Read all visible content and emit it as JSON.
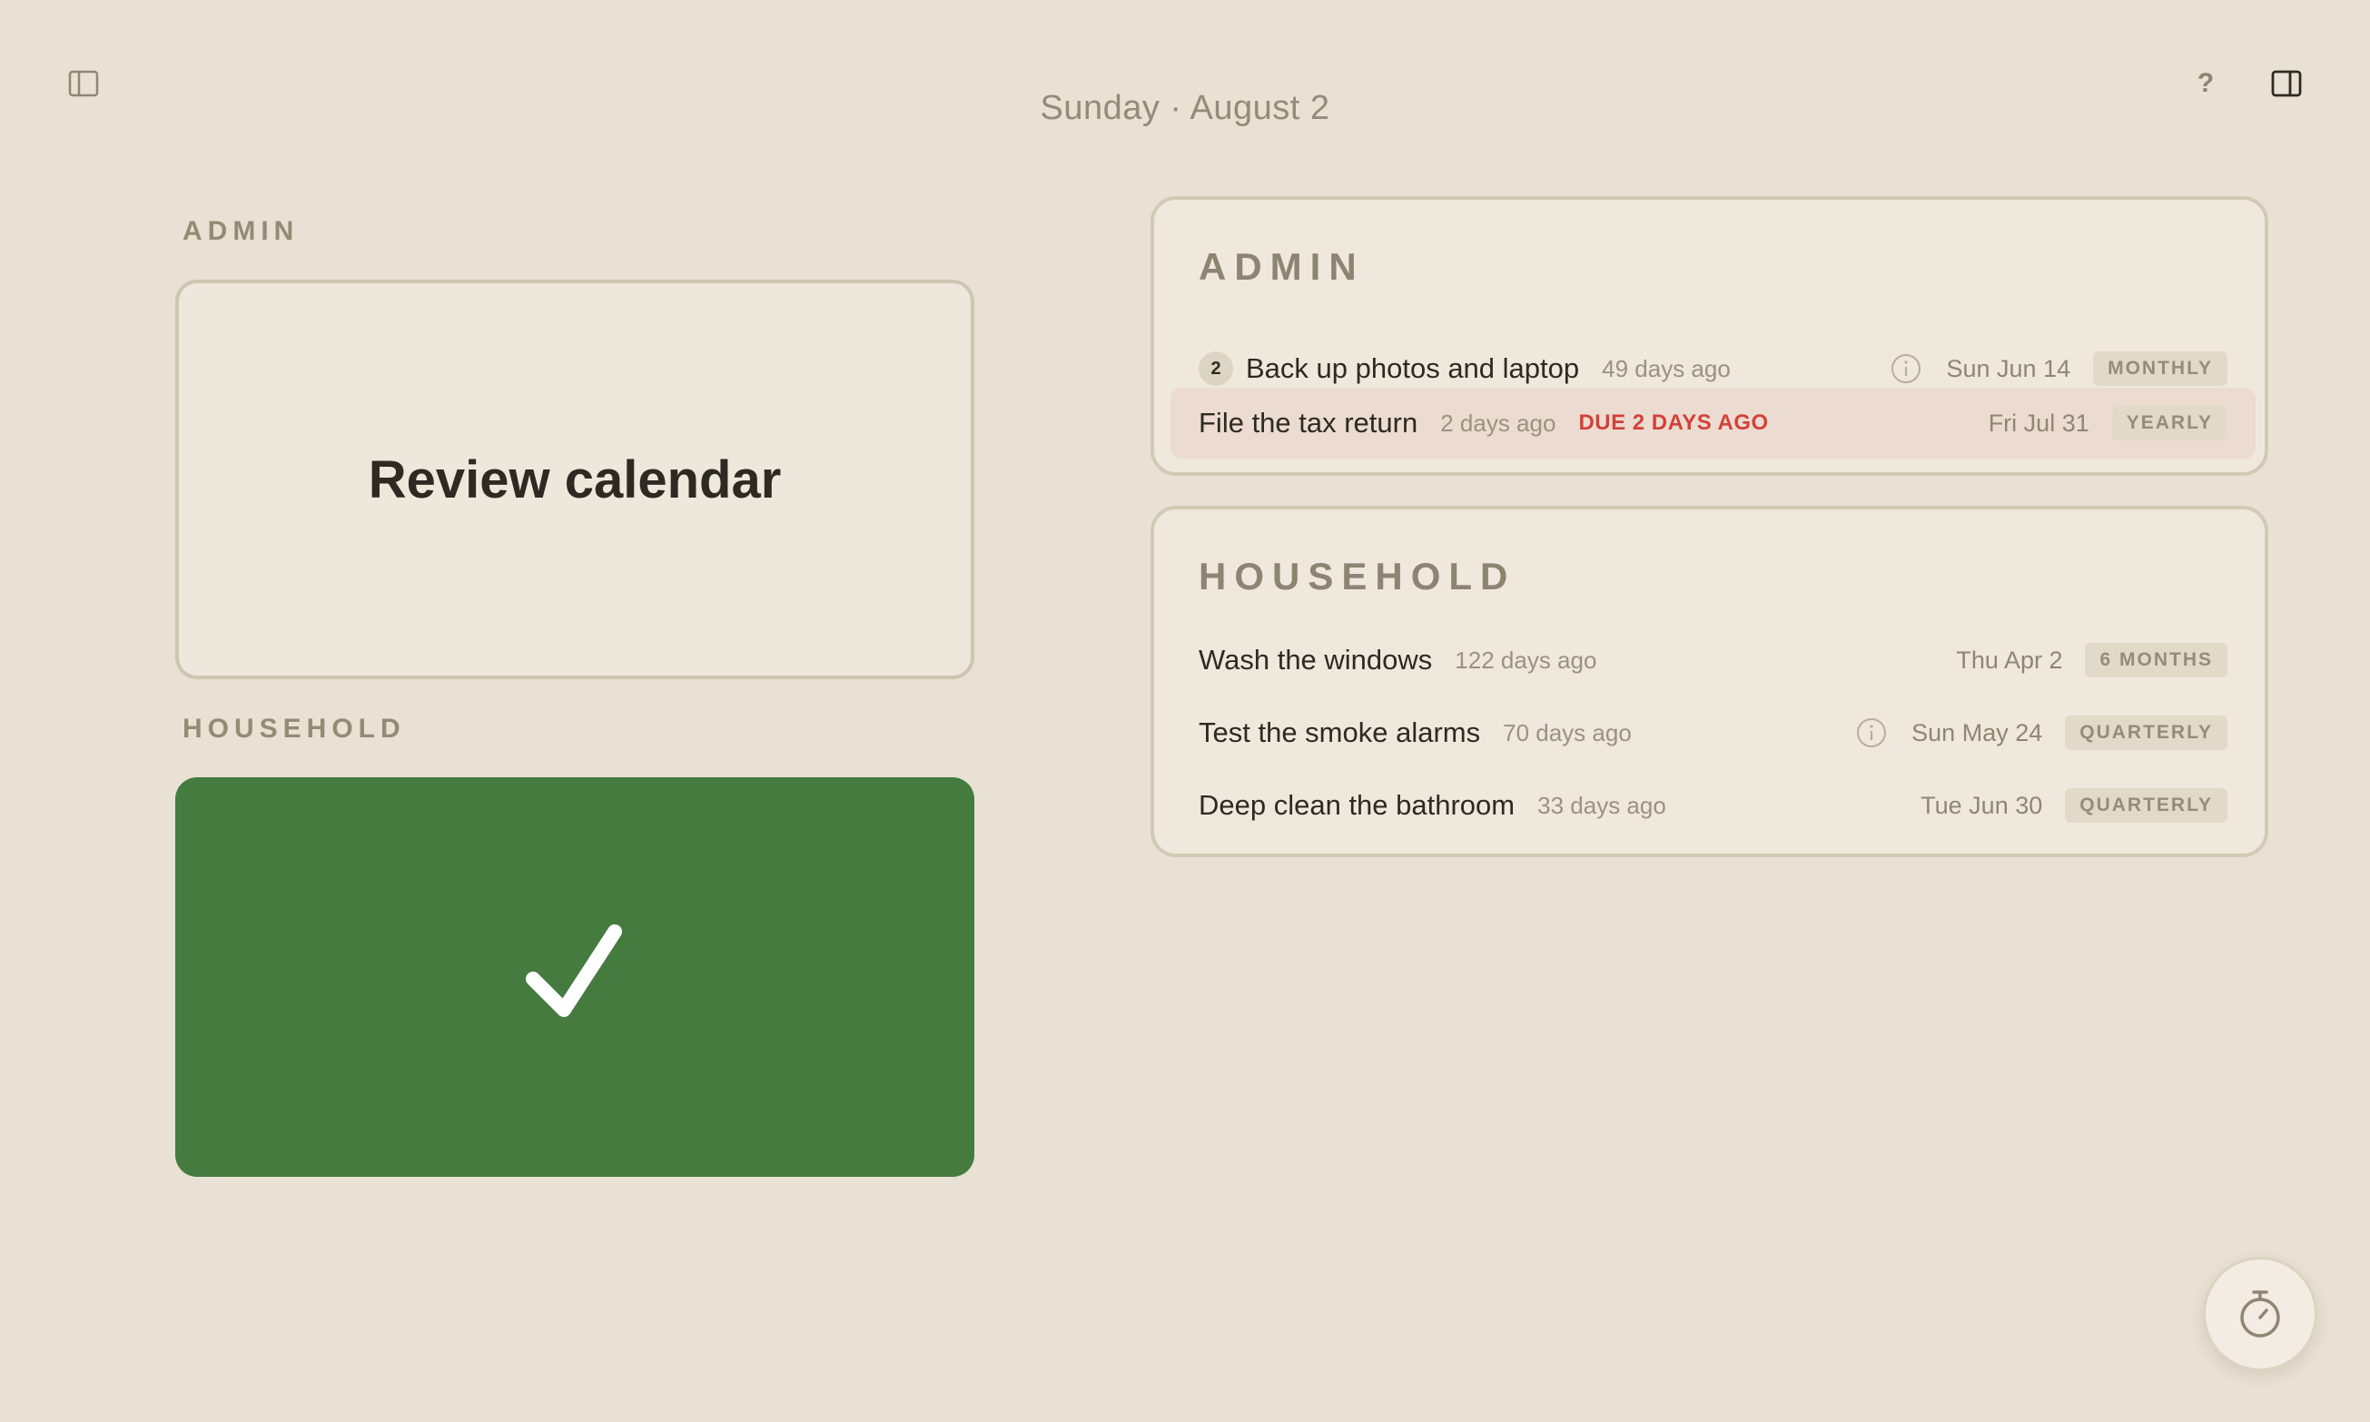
{
  "header": {
    "date_title": "Sunday · August 2",
    "help_label": "?",
    "icons": {
      "left": "sidebar-left-icon",
      "right": "sidebar-right-icon"
    }
  },
  "left": {
    "admin_label": "ADMIN",
    "admin_card_title": "Review calendar",
    "household_label": "HOUSEHOLD",
    "household_card_state": "completed",
    "household_card_icon": "checkmark-icon",
    "household_card_color": "#457b3f"
  },
  "panels": {
    "admin": {
      "title": "ADMIN",
      "tasks": [
        {
          "count": "2",
          "name": "Back up photos and laptop",
          "ago": "49 days ago",
          "info_icon": "info-icon",
          "date": "Sun Jun 14",
          "frequency": "MONTHLY"
        },
        {
          "name": "File the tax return",
          "ago": "2 days ago",
          "due": "DUE 2 DAYS AGO",
          "date": "Fri Jul 31",
          "frequency": "YEARLY",
          "overdue": true
        }
      ]
    },
    "household": {
      "title": "HOUSEHOLD",
      "tasks": [
        {
          "name": "Wash the windows",
          "ago": "122 days ago",
          "date": "Thu Apr 2",
          "frequency": "6 MONTHS"
        },
        {
          "name": "Test the smoke alarms",
          "ago": "70 days ago",
          "info_icon": "info-icon",
          "date": "Sun May 24",
          "frequency": "QUARTERLY"
        },
        {
          "name": "Deep clean the bathroom",
          "ago": "33 days ago",
          "date": "Tue Jun 30",
          "frequency": "QUARTERLY"
        }
      ]
    }
  },
  "timer": {
    "icon": "stopwatch-icon"
  },
  "colors": {
    "background": "#e8e1d4",
    "accent_green": "#457b3f",
    "overdue_red": "#d2413a",
    "overdue_row_bg": "#ecdbd0"
  }
}
